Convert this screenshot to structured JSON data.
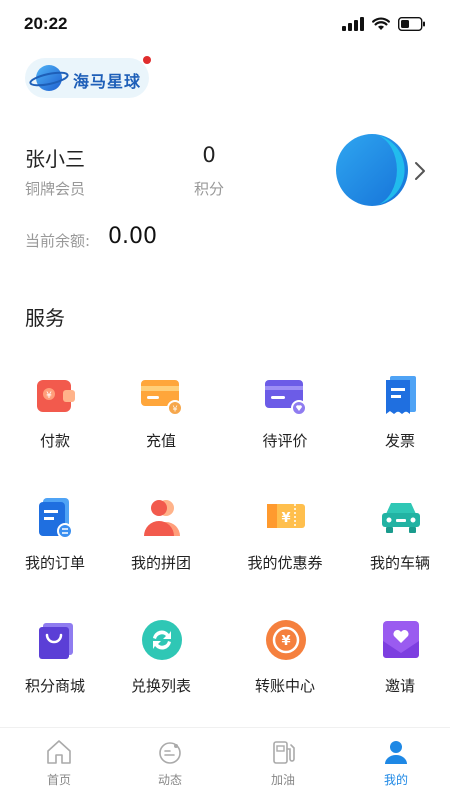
{
  "status_bar": {
    "time": "20:22",
    "icons": [
      "signal-icon",
      "wifi-icon",
      "battery-icon"
    ]
  },
  "logo": {
    "text": "海马星球"
  },
  "profile": {
    "name": "张小三",
    "level": "铜牌会员",
    "points_value": "0",
    "points_label": "积分",
    "balance_label": "当前余额:",
    "balance_value": "0.00"
  },
  "services": {
    "title": "服务",
    "items": [
      {
        "label": "付款",
        "icon": "wallet-icon"
      },
      {
        "label": "充值",
        "icon": "recharge-card-icon"
      },
      {
        "label": "待评价",
        "icon": "review-card-icon"
      },
      {
        "label": "发票",
        "icon": "invoice-icon"
      },
      {
        "label": "我的订单",
        "icon": "order-icon"
      },
      {
        "label": "我的拼团",
        "icon": "group-buy-icon"
      },
      {
        "label": "我的优惠券",
        "icon": "coupon-icon"
      },
      {
        "label": "我的车辆",
        "icon": "car-icon"
      },
      {
        "label": "积分商城",
        "icon": "shopping-bag-icon"
      },
      {
        "label": "兑换列表",
        "icon": "exchange-icon"
      },
      {
        "label": "转账中心",
        "icon": "transfer-icon"
      },
      {
        "label": "邀请",
        "icon": "invite-icon"
      }
    ]
  },
  "tab_bar": {
    "tabs": [
      {
        "label": "首页",
        "icon": "home-icon",
        "active": false
      },
      {
        "label": "动态",
        "icon": "planet-icon",
        "active": false
      },
      {
        "label": "加油",
        "icon": "fuel-pump-icon",
        "active": false
      },
      {
        "label": "我的",
        "icon": "user-icon",
        "active": true
      }
    ]
  },
  "colors": {
    "accent": "#1e88e5",
    "secondary_text": "#999999",
    "badge": "#e02d2d"
  }
}
